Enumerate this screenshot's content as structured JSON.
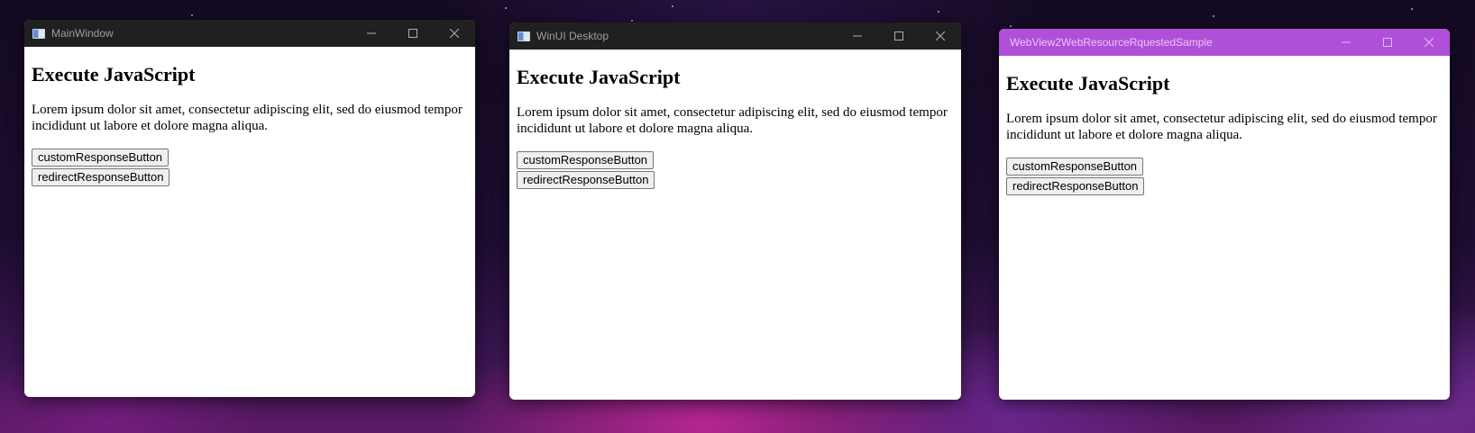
{
  "windows": [
    {
      "title": "MainWindow",
      "page": {
        "heading": "Execute JavaScript",
        "paragraph": "Lorem ipsum dolor sit amet, consectetur adipiscing elit, sed do eiusmod tempor incididunt ut labore et dolore magna aliqua.",
        "buttons": [
          "customResponseButton",
          "redirectResponseButton"
        ]
      }
    },
    {
      "title": "WinUI Desktop",
      "page": {
        "heading": "Execute JavaScript",
        "paragraph": "Lorem ipsum dolor sit amet, consectetur adipiscing elit, sed do eiusmod tempor incididunt ut labore et dolore magna aliqua.",
        "buttons": [
          "customResponseButton",
          "redirectResponseButton"
        ]
      }
    },
    {
      "title": "WebView2WebResourceRquestedSample",
      "page": {
        "heading": "Execute JavaScript",
        "paragraph": "Lorem ipsum dolor sit amet, consectetur adipiscing elit, sed do eiusmod tempor incididunt ut labore et dolore magna aliqua.",
        "buttons": [
          "customResponseButton",
          "redirectResponseButton"
        ]
      }
    }
  ],
  "icons": {
    "app": "app-window-icon",
    "minimize": "minimize-icon",
    "maximize": "maximize-icon",
    "close": "close-icon"
  },
  "colors": {
    "dark_titlebar": "#202020",
    "accent_titlebar": "#b04fd8",
    "page_background": "#ffffff"
  }
}
